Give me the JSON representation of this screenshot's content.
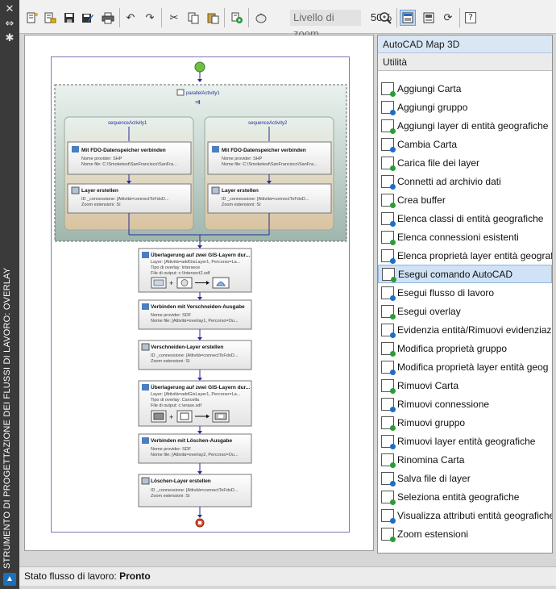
{
  "sidebar_title": "STRUMENTO DI PROGETTAZIONE DEI FLUSSI DI LAVORO: OVERLAY",
  "toolbar": {
    "zoom_label": "Livello di zoom",
    "zoom_value": "50%",
    "help_label": "?"
  },
  "panel": {
    "header": "AutoCAD Map 3D",
    "section": "Utilità",
    "items": [
      {
        "label": "Aggiungi Carta",
        "icon": "add-map-icon"
      },
      {
        "label": "Aggiungi gruppo",
        "icon": "add-group-icon"
      },
      {
        "label": "Aggiungi layer di entità geografiche",
        "icon": "add-feature-layer-icon"
      },
      {
        "label": "Cambia Carta",
        "icon": "change-map-icon"
      },
      {
        "label": "Carica file dei layer",
        "icon": "load-layer-file-icon"
      },
      {
        "label": "Connetti ad archivio dati",
        "icon": "connect-datastore-icon"
      },
      {
        "label": "Crea buffer",
        "icon": "create-buffer-icon"
      },
      {
        "label": "Elenca classi di entità geografiche",
        "icon": "list-feature-classes-icon"
      },
      {
        "label": "Elenca connessioni esistenti",
        "icon": "list-connections-icon"
      },
      {
        "label": "Elenca proprietà layer entità geograf",
        "icon": "list-layer-properties-icon"
      },
      {
        "label": "Esegui comando AutoCAD",
        "icon": "run-autocad-command-icon",
        "selected": true
      },
      {
        "label": "Esegui flusso di lavoro",
        "icon": "run-workflow-icon"
      },
      {
        "label": "Esegui overlay",
        "icon": "run-overlay-icon"
      },
      {
        "label": "Evidenzia entità/Rimuovi evidenziazi",
        "icon": "highlight-features-icon"
      },
      {
        "label": "Modifica proprietà gruppo",
        "icon": "edit-group-properties-icon"
      },
      {
        "label": "Modifica proprietà layer entità geog",
        "icon": "edit-layer-properties-icon"
      },
      {
        "label": "Rimuovi Carta",
        "icon": "remove-map-icon"
      },
      {
        "label": "Rimuovi connessione",
        "icon": "remove-connection-icon"
      },
      {
        "label": "Rimuovi gruppo",
        "icon": "remove-group-icon"
      },
      {
        "label": "Rimuovi layer entità geografiche",
        "icon": "remove-feature-layer-icon"
      },
      {
        "label": "Rinomina Carta",
        "icon": "rename-map-icon"
      },
      {
        "label": "Salva file di layer",
        "icon": "save-layer-file-icon"
      },
      {
        "label": "Seleziona entità geografiche",
        "icon": "select-features-icon"
      },
      {
        "label": "Visualizza attributi entità geografiche",
        "icon": "show-attributes-icon"
      },
      {
        "label": "Zoom estensioni",
        "icon": "zoom-extents-icon"
      }
    ]
  },
  "status": {
    "label": "Stato flusso di lavoro:",
    "value": "Pronto"
  },
  "diagram": {
    "parallel_title": "parallelActivity1",
    "seq1_title": "sequenceActivity1",
    "seq2_title": "sequenceActivity2",
    "connect1": {
      "title": "Mit FDO-Datenspeicher verbinden",
      "row1": "Nome provider:  SHP",
      "row2": "Nome file:  C:\\Smoketest\\SanFrancisco\\SanFra..."
    },
    "connect2": {
      "title": "Mit FDO-Datenspeicher verbinden",
      "row1": "Nome provider:  SHP",
      "row2": "Nome file:  C:\\Smoketest\\SanFrancisco\\SanFra..."
    },
    "layer1": {
      "title": "Layer erstellen",
      "row1": "ID _connessione:  [Attività=connectToFdoD...",
      "row2": "Zoom estensioni:  Sì"
    },
    "layer2": {
      "title": "Layer erstellen",
      "row1": "ID _connessione:  [Attività=connectToFdoD...",
      "row2": "Zoom estensioni:  Sì"
    },
    "overlay1": {
      "title": "Überlagerung auf zwei GIS-Layern dur...",
      "row1": "Layer:  [Attività=addGisLayer1, Percorso=La...",
      "row2": "Tipo di overlay:  Intersece",
      "row3": "File di output:  c:\\Intersect2.sdf"
    },
    "verschneiden": {
      "title": "Verbinden mit Verschneiden-Ausgabe",
      "row1": "Nome provider:  SDF",
      "row2": "Nome file:  [Attività=overlay1, Percorso=Ou..."
    },
    "verschneiden_layer": {
      "title": "Verschneiden-Layer erstellen",
      "row1": "ID _connessione:  [Attività=connectToFdoD...",
      "row2": "Zoom estensioni:  Sì"
    },
    "overlay2": {
      "title": "Überlagerung auf zwei GIS-Layern dur...",
      "row1": "Layer:  [Attività=addGisLayer1, Percorso=La...",
      "row2": "Tipo di overlay:  Cancella",
      "row3": "File di output:  c:\\erase.sdf"
    },
    "loeschen": {
      "title": "Verbinden mit Löschen-Ausgabe",
      "row1": "Nome provider:  SDF",
      "row2": "Nome file:  [Attività=overlay2, Percorso=Ou..."
    },
    "loeschen_layer": {
      "title": "Löschen-Layer erstellen",
      "row1": "ID _connessione:  [Attività=connectToFdoD...",
      "row2": "Zoom estensioni:  Sì"
    }
  }
}
